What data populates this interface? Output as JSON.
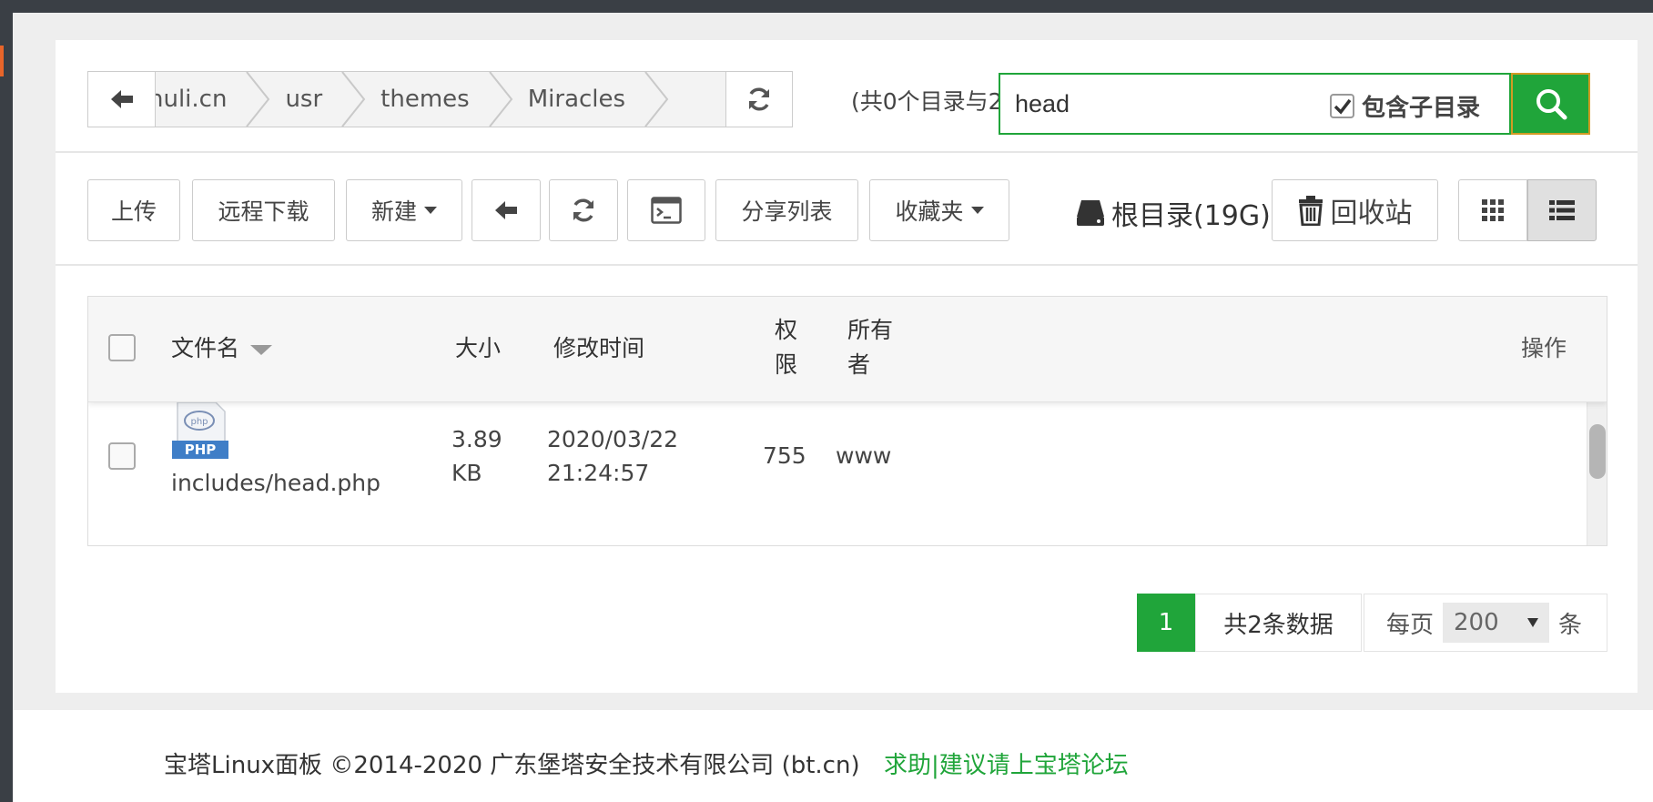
{
  "breadcrumb": {
    "items": [
      "nuli.cn",
      "usr",
      "themes",
      "Miracles"
    ]
  },
  "summary_text": "(共0个目录与2",
  "search": {
    "value": "head",
    "include_subdirs_label": "包含子目录",
    "include_subdirs_checked": true
  },
  "toolbar": {
    "upload": "上传",
    "remote_download": "远程下载",
    "new": "新建",
    "share_list": "分享列表",
    "favorites": "收藏夹",
    "root_disk": "根目录(19G)",
    "recycle_bin": "回收站"
  },
  "table": {
    "headers": {
      "name": "文件名",
      "size": "大小",
      "mtime": "修改时间",
      "perm_line1": "权",
      "perm_line2": "限",
      "owner_line1": "所有",
      "owner_line2": "者",
      "actions": "操作"
    },
    "rows": [
      {
        "icon_label": "PHP",
        "name": "includes/head.php",
        "size_line1": "3.89",
        "size_line2": "KB",
        "date": "2020/03/22",
        "time": "21:24:57",
        "perm": "755",
        "owner": "www"
      }
    ]
  },
  "pagination": {
    "current_page": "1",
    "total": "共2条数据",
    "per_page_prefix": "每页",
    "per_page_value": "200",
    "per_page_suffix": "条"
  },
  "footer": {
    "copyright": "宝塔Linux面板 ©2014-2020 广东堡塔安全技术有限公司 (bt.cn)",
    "help_link": "求助|建议请上宝塔论坛"
  },
  "colors": {
    "accent": "#20a53a",
    "search_btn_border": "#d29b24"
  }
}
